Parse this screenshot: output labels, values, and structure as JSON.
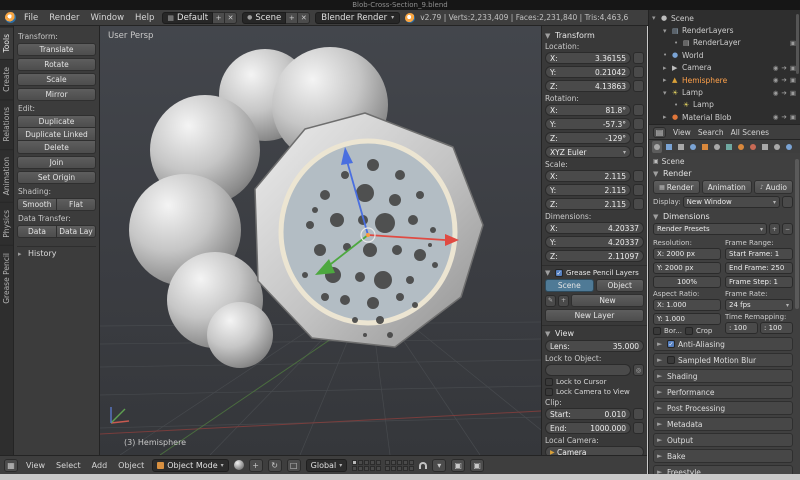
{
  "window": {
    "title": "Blob-Cross-Section_9.blend"
  },
  "icons": {
    "expander_open": "▾",
    "expander_closed": "▸",
    "dot": "•",
    "dropdown": "▾",
    "panel_open": "▼",
    "panel_closed": "►",
    "plus": "+",
    "minus": "−",
    "close": "✕",
    "check": "✓",
    "eye": "◉",
    "select_arrow": "➔",
    "render_cam": "▣",
    "scene": "●",
    "layers": "▤",
    "world": "●",
    "camera_obj": "▶",
    "mesh": "▲",
    "lamp": "☀",
    "material": "●",
    "pencil": "✎",
    "eyedropper": "◎",
    "speaker": "♪",
    "image": "▦",
    "translate_manip": "+",
    "rotate_manip": "↻",
    "scale_manip": "□"
  },
  "menubar": {
    "menus": [
      "File",
      "Render",
      "Window",
      "Help"
    ],
    "layout": "Default",
    "scene": "Scene",
    "engine": "Blender Render",
    "stats": "v2.79 | Verts:2,233,409 | Faces:2,231,840 | Tris:4,463,6"
  },
  "tool_tabs": {
    "tabs": [
      "Tools",
      "Create",
      "Relations",
      "Animation",
      "Physics",
      "Grease Pencil"
    ]
  },
  "tool_shelf": {
    "transform_label": "Transform:",
    "translate": "Translate",
    "rotate": "Rotate",
    "scale": "Scale",
    "mirror": "Mirror",
    "edit_label": "Edit:",
    "duplicate": "Duplicate",
    "duplicate_linked": "Duplicate Linked",
    "delete": "Delete",
    "join": "Join",
    "set_origin": "Set Origin",
    "shading_label": "Shading:",
    "smooth": "Smooth",
    "flat": "Flat",
    "data_transfer_label": "Data Transfer:",
    "data": "Data",
    "data_lay": "Data Lay",
    "history": "History"
  },
  "viewport": {
    "view_label": "User Persp",
    "object_label": "(3) Hemisphere"
  },
  "viewport_header": {
    "menus": [
      "View",
      "Select",
      "Add",
      "Object"
    ],
    "mode": "Object Mode",
    "orientation": "Global"
  },
  "n_panel": {
    "transform_title": "Transform",
    "axis": {
      "x": "X:",
      "y": "Y:",
      "z": "Z:"
    },
    "location_label": "Location:",
    "location": {
      "x": "3.36155",
      "y": "0.21042",
      "z": "4.13863"
    },
    "rotation_label": "Rotation:",
    "rotation": {
      "x": "81.8°",
      "y": "-57.3°",
      "z": "-129°"
    },
    "euler_mode": "XYZ Euler",
    "scale_label": "Scale:",
    "scale": {
      "x": "2.115",
      "y": "2.115",
      "z": "2.115"
    },
    "dimensions_label": "Dimensions:",
    "dimensions": {
      "x": "4.20337",
      "y": "4.20337",
      "z": "2.11097"
    },
    "gp_title": "Grease Pencil Layers",
    "gp_scene": "Scene",
    "gp_object": "Object",
    "gp_new": "New",
    "gp_new_layer": "New Layer",
    "view_title": "View",
    "lens_label": "Lens:",
    "lens_value": "35.000",
    "lock_to_object_label": "Lock to Object:",
    "lock_to_cursor": "Lock to Cursor",
    "lock_camera_to_view": "Lock Camera to View",
    "clip_label": "Clip:",
    "clip_start_label": "Start:",
    "clip_start": "0.010",
    "clip_end_label": "End:",
    "clip_end": "1000.000",
    "local_camera_label": "Local Camera:",
    "local_camera": "Camera"
  },
  "outliner": {
    "rows": [
      {
        "label": "Scene"
      },
      {
        "label": "RenderLayers"
      },
      {
        "label": "RenderLayer"
      },
      {
        "label": "World"
      },
      {
        "label": "Camera"
      },
      {
        "label": "Hemisphere"
      },
      {
        "label": "Lamp"
      },
      {
        "label": "Lamp"
      },
      {
        "label": "Material Blob"
      }
    ],
    "footer": {
      "view": "View",
      "search": "Search",
      "all_scenes": "All Scenes"
    }
  },
  "properties": {
    "breadcrumb": "Scene",
    "render_title": "Render",
    "btn_render": "Render",
    "btn_animation": "Animation",
    "btn_audio": "Audio",
    "display_label": "Display:",
    "display_value": "New Window",
    "dimensions_title": "Dimensions",
    "presets": "Render Presets",
    "resolution_label": "Resolution:",
    "res_x": "X: 2000 px",
    "res_y": "Y: 2000 px",
    "res_pct": "100%",
    "frame_range_label": "Frame Range:",
    "start_frame": "Start Frame: 1",
    "end_frame": "End Frame: 250",
    "frame_step": "Frame Step: 1",
    "aspect_label": "Aspect Ratio:",
    "aspect_x": "X: 1.000",
    "aspect_y": "Y: 1.000",
    "frame_rate_label": "Frame Rate:",
    "fps": "24 fps",
    "border": "Bor...",
    "crop": "Crop",
    "time_remap_label": "Time Remapping:",
    "remap_old": ": 100",
    "remap_new": ": 100",
    "collapsed": [
      "Anti-Aliasing",
      "Sampled Motion Blur",
      "Shading",
      "Performance",
      "Post Processing",
      "Metadata",
      "Output",
      "Bake",
      "Freestyle"
    ]
  }
}
